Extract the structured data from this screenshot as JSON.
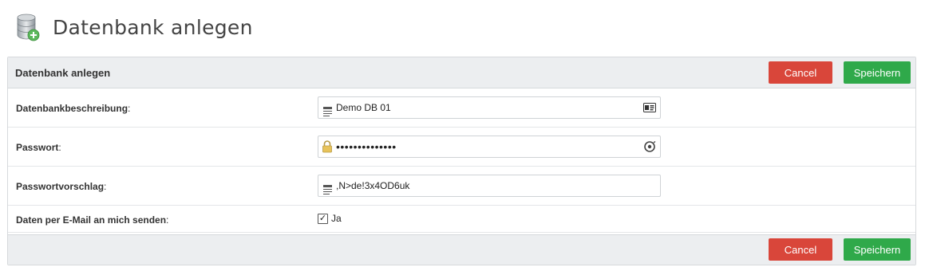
{
  "header": {
    "title": "Datenbank anlegen",
    "icon": "database-add-icon"
  },
  "panel": {
    "title": "Datenbank anlegen",
    "cancel_label": "Cancel",
    "save_label": "Speichern"
  },
  "form": {
    "description": {
      "label": "Datenbankbeschreibung",
      "value": "Demo DB 01",
      "lead_icon": "text-lines-icon",
      "trail_icon": "id-card-icon"
    },
    "password": {
      "label": "Passwort",
      "value": "••••••••••••••",
      "lead_icon": "lock-icon",
      "trail_icon": "reveal-password-icon"
    },
    "suggestion": {
      "label": "Passwortvorschlag",
      "value": ",N>de!3x4OD6uk",
      "lead_icon": "text-lines-icon"
    },
    "email": {
      "label": "Daten per E-Mail an mich senden",
      "checked": true,
      "option_label": "Ja"
    }
  },
  "footer": {
    "cancel_label": "Cancel",
    "save_label": "Speichern"
  },
  "colors": {
    "cancel": "#d9463a",
    "save": "#2fa94a",
    "panel_bg": "#eceef0"
  }
}
